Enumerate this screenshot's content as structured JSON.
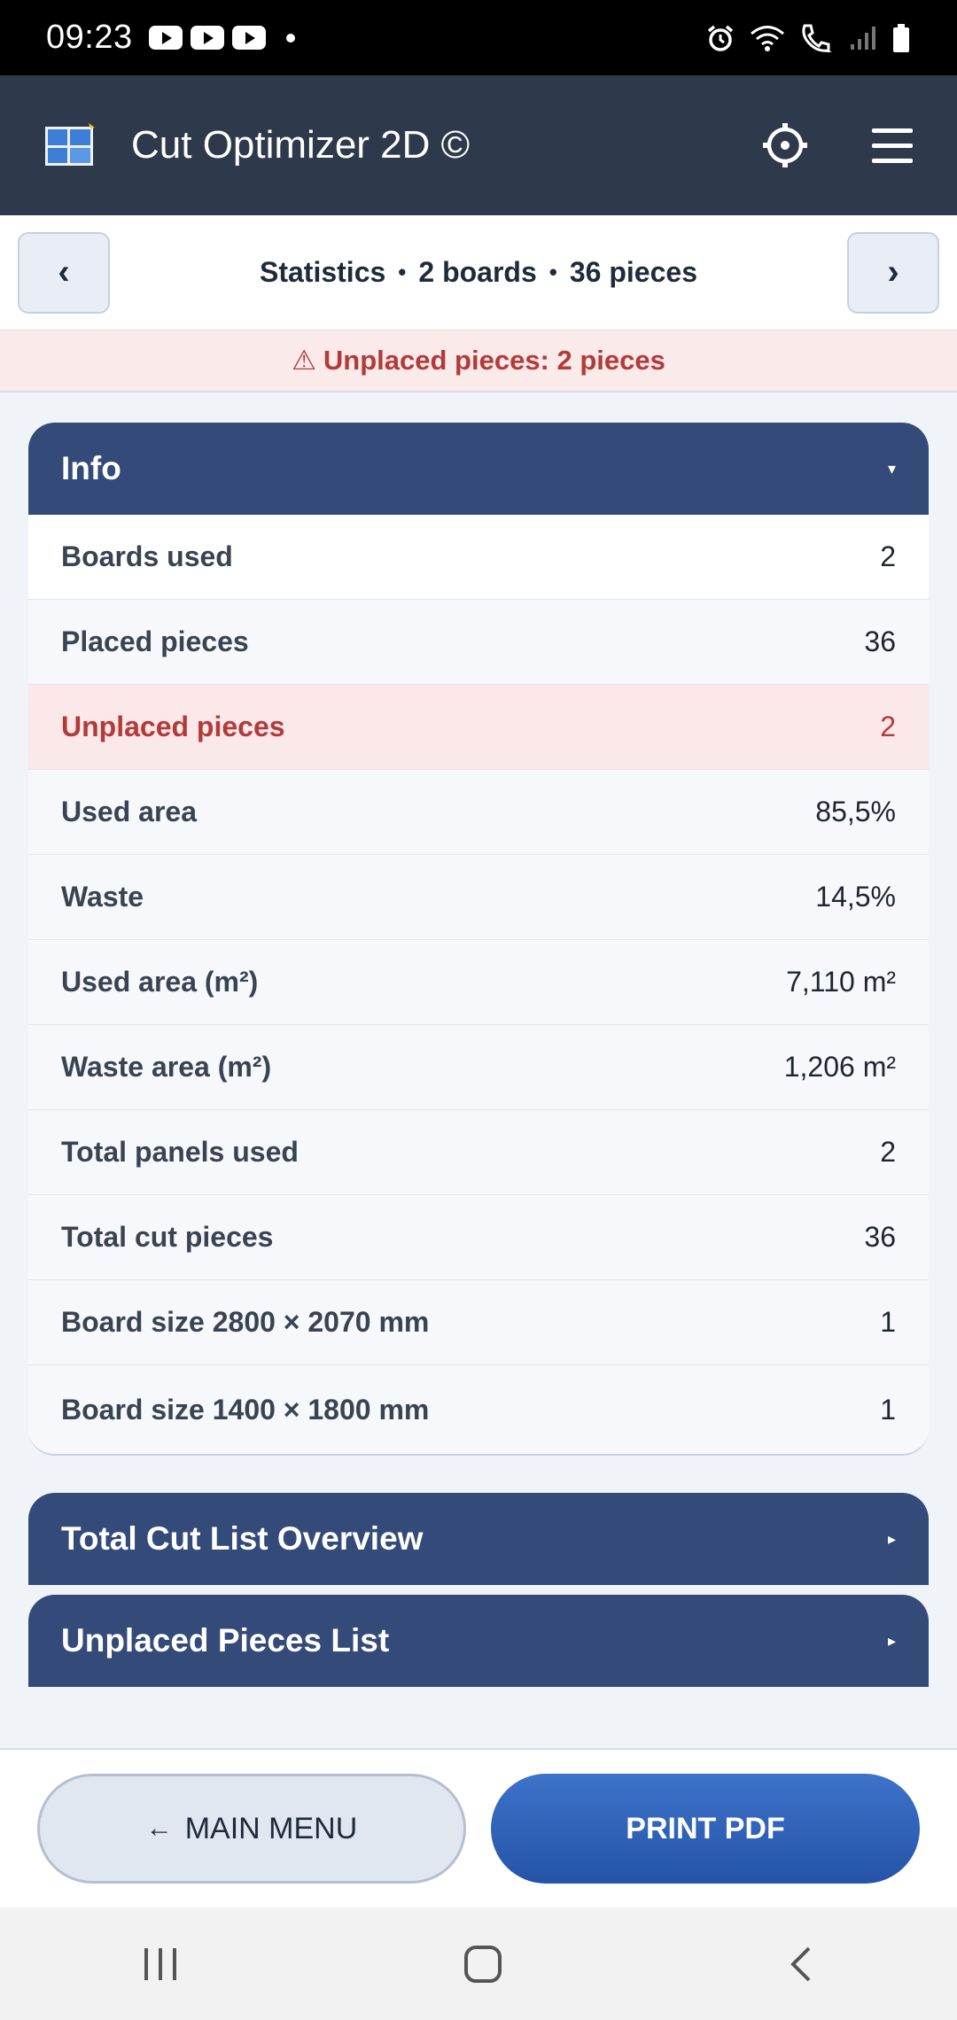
{
  "status_bar": {
    "time": "09:23",
    "notification_icons": [
      "youtube-icon",
      "youtube-icon",
      "youtube-icon"
    ],
    "right_icons": [
      "alarm-icon",
      "wifi-icon",
      "call-icon",
      "signal-icon",
      "battery-icon"
    ]
  },
  "app_header": {
    "title": "Cut Optimizer 2D ©",
    "icons": [
      "app-logo-icon",
      "settings-icon",
      "menu-icon"
    ]
  },
  "nav": {
    "prev_label": "‹",
    "next_label": "›",
    "section": "Statistics",
    "separator": "•",
    "boards": "2 boards",
    "pieces": "36 pieces"
  },
  "warning": {
    "icon": "⚠",
    "text": "Unplaced pieces: 2 pieces"
  },
  "info_panel": {
    "title": "Info",
    "caret": "▾",
    "rows": [
      {
        "label": "Boards used",
        "value": "2"
      },
      {
        "label": "Placed pieces",
        "value": "36"
      },
      {
        "label": "Unplaced pieces",
        "value": "2"
      },
      {
        "label": "Used area",
        "value": "85,5%"
      },
      {
        "label": "Waste",
        "value": "14,5%"
      },
      {
        "label": "Used area (m²)",
        "value": "7,110 m²"
      },
      {
        "label": "Waste area (m²)",
        "value": "1,206 m²"
      },
      {
        "label": "Total panels used",
        "value": "2"
      },
      {
        "label": "Total cut pieces",
        "value": "36"
      },
      {
        "label": "Board size 2800 × 2070 mm",
        "value": "1"
      },
      {
        "label": "Board size 1400 × 1800 mm",
        "value": "1"
      }
    ]
  },
  "cutlist_panel": {
    "title": "Total Cut List Overview",
    "caret": "▸"
  },
  "unplaced_panel": {
    "title": "Unplaced Pieces List",
    "caret": "▸"
  },
  "footer": {
    "main_menu_arrow": "←",
    "main_menu_label": "MAIN MENU",
    "print_label": "PRINT PDF"
  },
  "system_nav": {
    "icons": [
      "recents-icon",
      "home-icon",
      "back-icon"
    ]
  },
  "colors": {
    "header_bg": "#2e3a4b",
    "panel_header": "#344a78",
    "alert_red": "#b43a3a",
    "print_button": "#2f63b8"
  }
}
